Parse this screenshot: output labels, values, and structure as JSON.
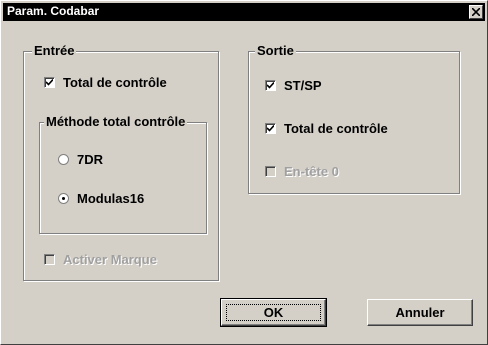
{
  "window": {
    "title": "Param. Codabar",
    "close_icon": "close-icon"
  },
  "entree": {
    "label": "Entrée",
    "total_controle": {
      "label": "Total de contrôle",
      "checked": true
    },
    "methode": {
      "label": "Méthode total contrôle",
      "options": [
        {
          "label": "7DR",
          "selected": false
        },
        {
          "label": "Modulas16",
          "selected": true
        }
      ]
    },
    "activer_marque": {
      "label": "Activer Marque",
      "checked": false,
      "disabled": true
    }
  },
  "sortie": {
    "label": "Sortie",
    "st_sp": {
      "label": "ST/SP",
      "checked": true
    },
    "total_controle": {
      "label": "Total de contrôle",
      "checked": true
    },
    "entete_0": {
      "label": "En-tête 0",
      "checked": false,
      "disabled": true
    }
  },
  "buttons": {
    "ok": "OK",
    "cancel": "Annuler"
  }
}
